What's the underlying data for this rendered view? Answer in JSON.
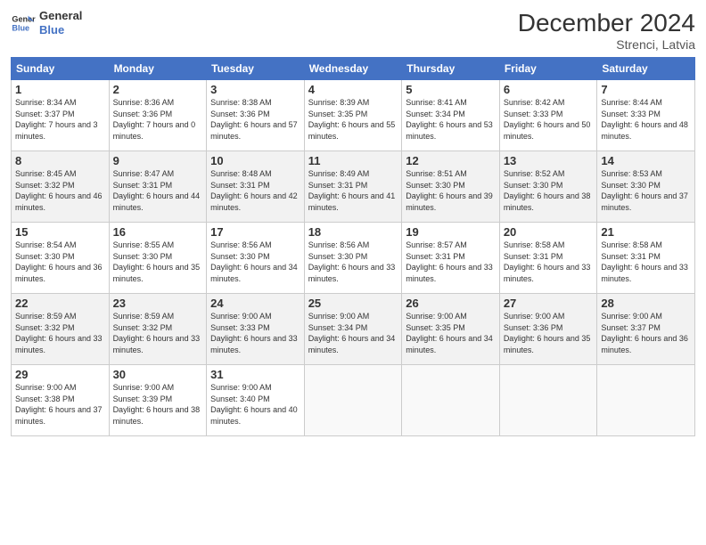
{
  "logo": {
    "line1": "General",
    "line2": "Blue"
  },
  "title": "December 2024",
  "subtitle": "Strenci, Latvia",
  "days_header": [
    "Sunday",
    "Monday",
    "Tuesday",
    "Wednesday",
    "Thursday",
    "Friday",
    "Saturday"
  ],
  "weeks": [
    [
      {
        "num": "1",
        "sunrise": "8:34 AM",
        "sunset": "3:37 PM",
        "daylight": "7 hours and 3 minutes."
      },
      {
        "num": "2",
        "sunrise": "8:36 AM",
        "sunset": "3:36 PM",
        "daylight": "7 hours and 0 minutes."
      },
      {
        "num": "3",
        "sunrise": "8:38 AM",
        "sunset": "3:36 PM",
        "daylight": "6 hours and 57 minutes."
      },
      {
        "num": "4",
        "sunrise": "8:39 AM",
        "sunset": "3:35 PM",
        "daylight": "6 hours and 55 minutes."
      },
      {
        "num": "5",
        "sunrise": "8:41 AM",
        "sunset": "3:34 PM",
        "daylight": "6 hours and 53 minutes."
      },
      {
        "num": "6",
        "sunrise": "8:42 AM",
        "sunset": "3:33 PM",
        "daylight": "6 hours and 50 minutes."
      },
      {
        "num": "7",
        "sunrise": "8:44 AM",
        "sunset": "3:33 PM",
        "daylight": "6 hours and 48 minutes."
      }
    ],
    [
      {
        "num": "8",
        "sunrise": "8:45 AM",
        "sunset": "3:32 PM",
        "daylight": "6 hours and 46 minutes."
      },
      {
        "num": "9",
        "sunrise": "8:47 AM",
        "sunset": "3:31 PM",
        "daylight": "6 hours and 44 minutes."
      },
      {
        "num": "10",
        "sunrise": "8:48 AM",
        "sunset": "3:31 PM",
        "daylight": "6 hours and 42 minutes."
      },
      {
        "num": "11",
        "sunrise": "8:49 AM",
        "sunset": "3:31 PM",
        "daylight": "6 hours and 41 minutes."
      },
      {
        "num": "12",
        "sunrise": "8:51 AM",
        "sunset": "3:30 PM",
        "daylight": "6 hours and 39 minutes."
      },
      {
        "num": "13",
        "sunrise": "8:52 AM",
        "sunset": "3:30 PM",
        "daylight": "6 hours and 38 minutes."
      },
      {
        "num": "14",
        "sunrise": "8:53 AM",
        "sunset": "3:30 PM",
        "daylight": "6 hours and 37 minutes."
      }
    ],
    [
      {
        "num": "15",
        "sunrise": "8:54 AM",
        "sunset": "3:30 PM",
        "daylight": "6 hours and 36 minutes."
      },
      {
        "num": "16",
        "sunrise": "8:55 AM",
        "sunset": "3:30 PM",
        "daylight": "6 hours and 35 minutes."
      },
      {
        "num": "17",
        "sunrise": "8:56 AM",
        "sunset": "3:30 PM",
        "daylight": "6 hours and 34 minutes."
      },
      {
        "num": "18",
        "sunrise": "8:56 AM",
        "sunset": "3:30 PM",
        "daylight": "6 hours and 33 minutes."
      },
      {
        "num": "19",
        "sunrise": "8:57 AM",
        "sunset": "3:31 PM",
        "daylight": "6 hours and 33 minutes."
      },
      {
        "num": "20",
        "sunrise": "8:58 AM",
        "sunset": "3:31 PM",
        "daylight": "6 hours and 33 minutes."
      },
      {
        "num": "21",
        "sunrise": "8:58 AM",
        "sunset": "3:31 PM",
        "daylight": "6 hours and 33 minutes."
      }
    ],
    [
      {
        "num": "22",
        "sunrise": "8:59 AM",
        "sunset": "3:32 PM",
        "daylight": "6 hours and 33 minutes."
      },
      {
        "num": "23",
        "sunrise": "8:59 AM",
        "sunset": "3:32 PM",
        "daylight": "6 hours and 33 minutes."
      },
      {
        "num": "24",
        "sunrise": "9:00 AM",
        "sunset": "3:33 PM",
        "daylight": "6 hours and 33 minutes."
      },
      {
        "num": "25",
        "sunrise": "9:00 AM",
        "sunset": "3:34 PM",
        "daylight": "6 hours and 34 minutes."
      },
      {
        "num": "26",
        "sunrise": "9:00 AM",
        "sunset": "3:35 PM",
        "daylight": "6 hours and 34 minutes."
      },
      {
        "num": "27",
        "sunrise": "9:00 AM",
        "sunset": "3:36 PM",
        "daylight": "6 hours and 35 minutes."
      },
      {
        "num": "28",
        "sunrise": "9:00 AM",
        "sunset": "3:37 PM",
        "daylight": "6 hours and 36 minutes."
      }
    ],
    [
      {
        "num": "29",
        "sunrise": "9:00 AM",
        "sunset": "3:38 PM",
        "daylight": "6 hours and 37 minutes."
      },
      {
        "num": "30",
        "sunrise": "9:00 AM",
        "sunset": "3:39 PM",
        "daylight": "6 hours and 38 minutes."
      },
      {
        "num": "31",
        "sunrise": "9:00 AM",
        "sunset": "3:40 PM",
        "daylight": "6 hours and 40 minutes."
      },
      null,
      null,
      null,
      null
    ]
  ]
}
